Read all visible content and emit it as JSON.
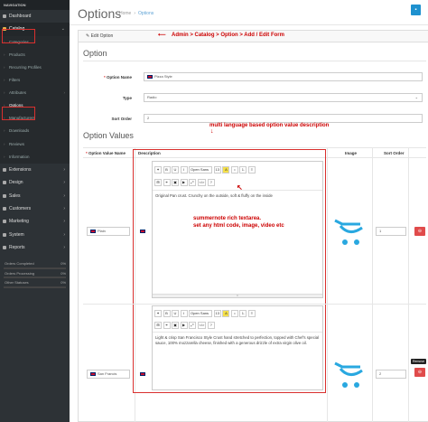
{
  "sidebar": {
    "header": "NAVIGATION",
    "items": [
      {
        "label": "Dashboard",
        "icon": "dashboard-icon"
      },
      {
        "label": "Catalog",
        "icon": "tags-icon",
        "active": true
      },
      {
        "label": "Extensions",
        "icon": "puzzle-icon"
      },
      {
        "label": "Design",
        "icon": "desktop-icon"
      },
      {
        "label": "Sales",
        "icon": "cart-icon"
      },
      {
        "label": "Customers",
        "icon": "user-icon"
      },
      {
        "label": "Marketing",
        "icon": "share-icon"
      },
      {
        "label": "System",
        "icon": "cog-icon"
      },
      {
        "label": "Reports",
        "icon": "bar-chart-icon"
      }
    ],
    "catalog_sub": [
      "Categories",
      "Products",
      "Recurring Profiles",
      "Filters",
      "Attributes",
      "Options",
      "Manufacturers",
      "Downloads",
      "Reviews",
      "Information"
    ],
    "stats": [
      {
        "label": "Orders Completed",
        "pct": "0%",
        "value": 0
      },
      {
        "label": "Orders Processing",
        "pct": "0%",
        "value": 0
      },
      {
        "label": "Other Statuses",
        "pct": "0%",
        "value": 0
      }
    ]
  },
  "header": {
    "title": "Options",
    "breadcrumb": [
      "Home",
      "Options"
    ],
    "save_icon": "save-icon"
  },
  "panel": {
    "heading": "Edit Option",
    "heading_icon": "pencil-icon"
  },
  "annotations": {
    "path": "Admin > Catalog > Option > Add / Edit Form",
    "multilang": "multi language based option value description",
    "summernote": "summernote rich textarea.\nset any html code, image, video etc"
  },
  "form": {
    "section_option": "Option",
    "option_name_label": "Option Name",
    "option_name_value": "Pizza Style",
    "type_label": "Type",
    "type_value": "Radio",
    "sort_label": "Sort Order",
    "sort_value": "2"
  },
  "values": {
    "section": "Option Values",
    "columns": [
      "Option Value Name",
      "Description",
      "Image",
      "Sort Order"
    ],
    "toolbar_row1": [
      "B",
      "U",
      "I",
      "Open Sans",
      "13",
      "A",
      "•",
      "1.",
      "≡"
    ],
    "toolbar_row2": [
      "⊞",
      "⚭",
      "▣",
      "▶",
      "⤢",
      "</>",
      "?"
    ],
    "rows": [
      {
        "name": "Plain",
        "description": "Original Pan crust. Crunchy on the outside, soft & fluffy on the inside",
        "sort": "1"
      },
      {
        "name": "San Francisco Style Crust",
        "name_display": "San Francis",
        "description": "Light & crisp San Francisco Style Crust hand stretched to perfection, topped with Chef's special sauce, 100% mozzarella cheese, finished with a generous drizzle of extra virgin olive oil.",
        "sort": "2"
      }
    ],
    "remove_tooltip": "Remove"
  },
  "colors": {
    "accent": "#1e91cf",
    "annotation": "#d9302e",
    "sidebar": "#2d3236",
    "danger": "#e04b4b"
  }
}
